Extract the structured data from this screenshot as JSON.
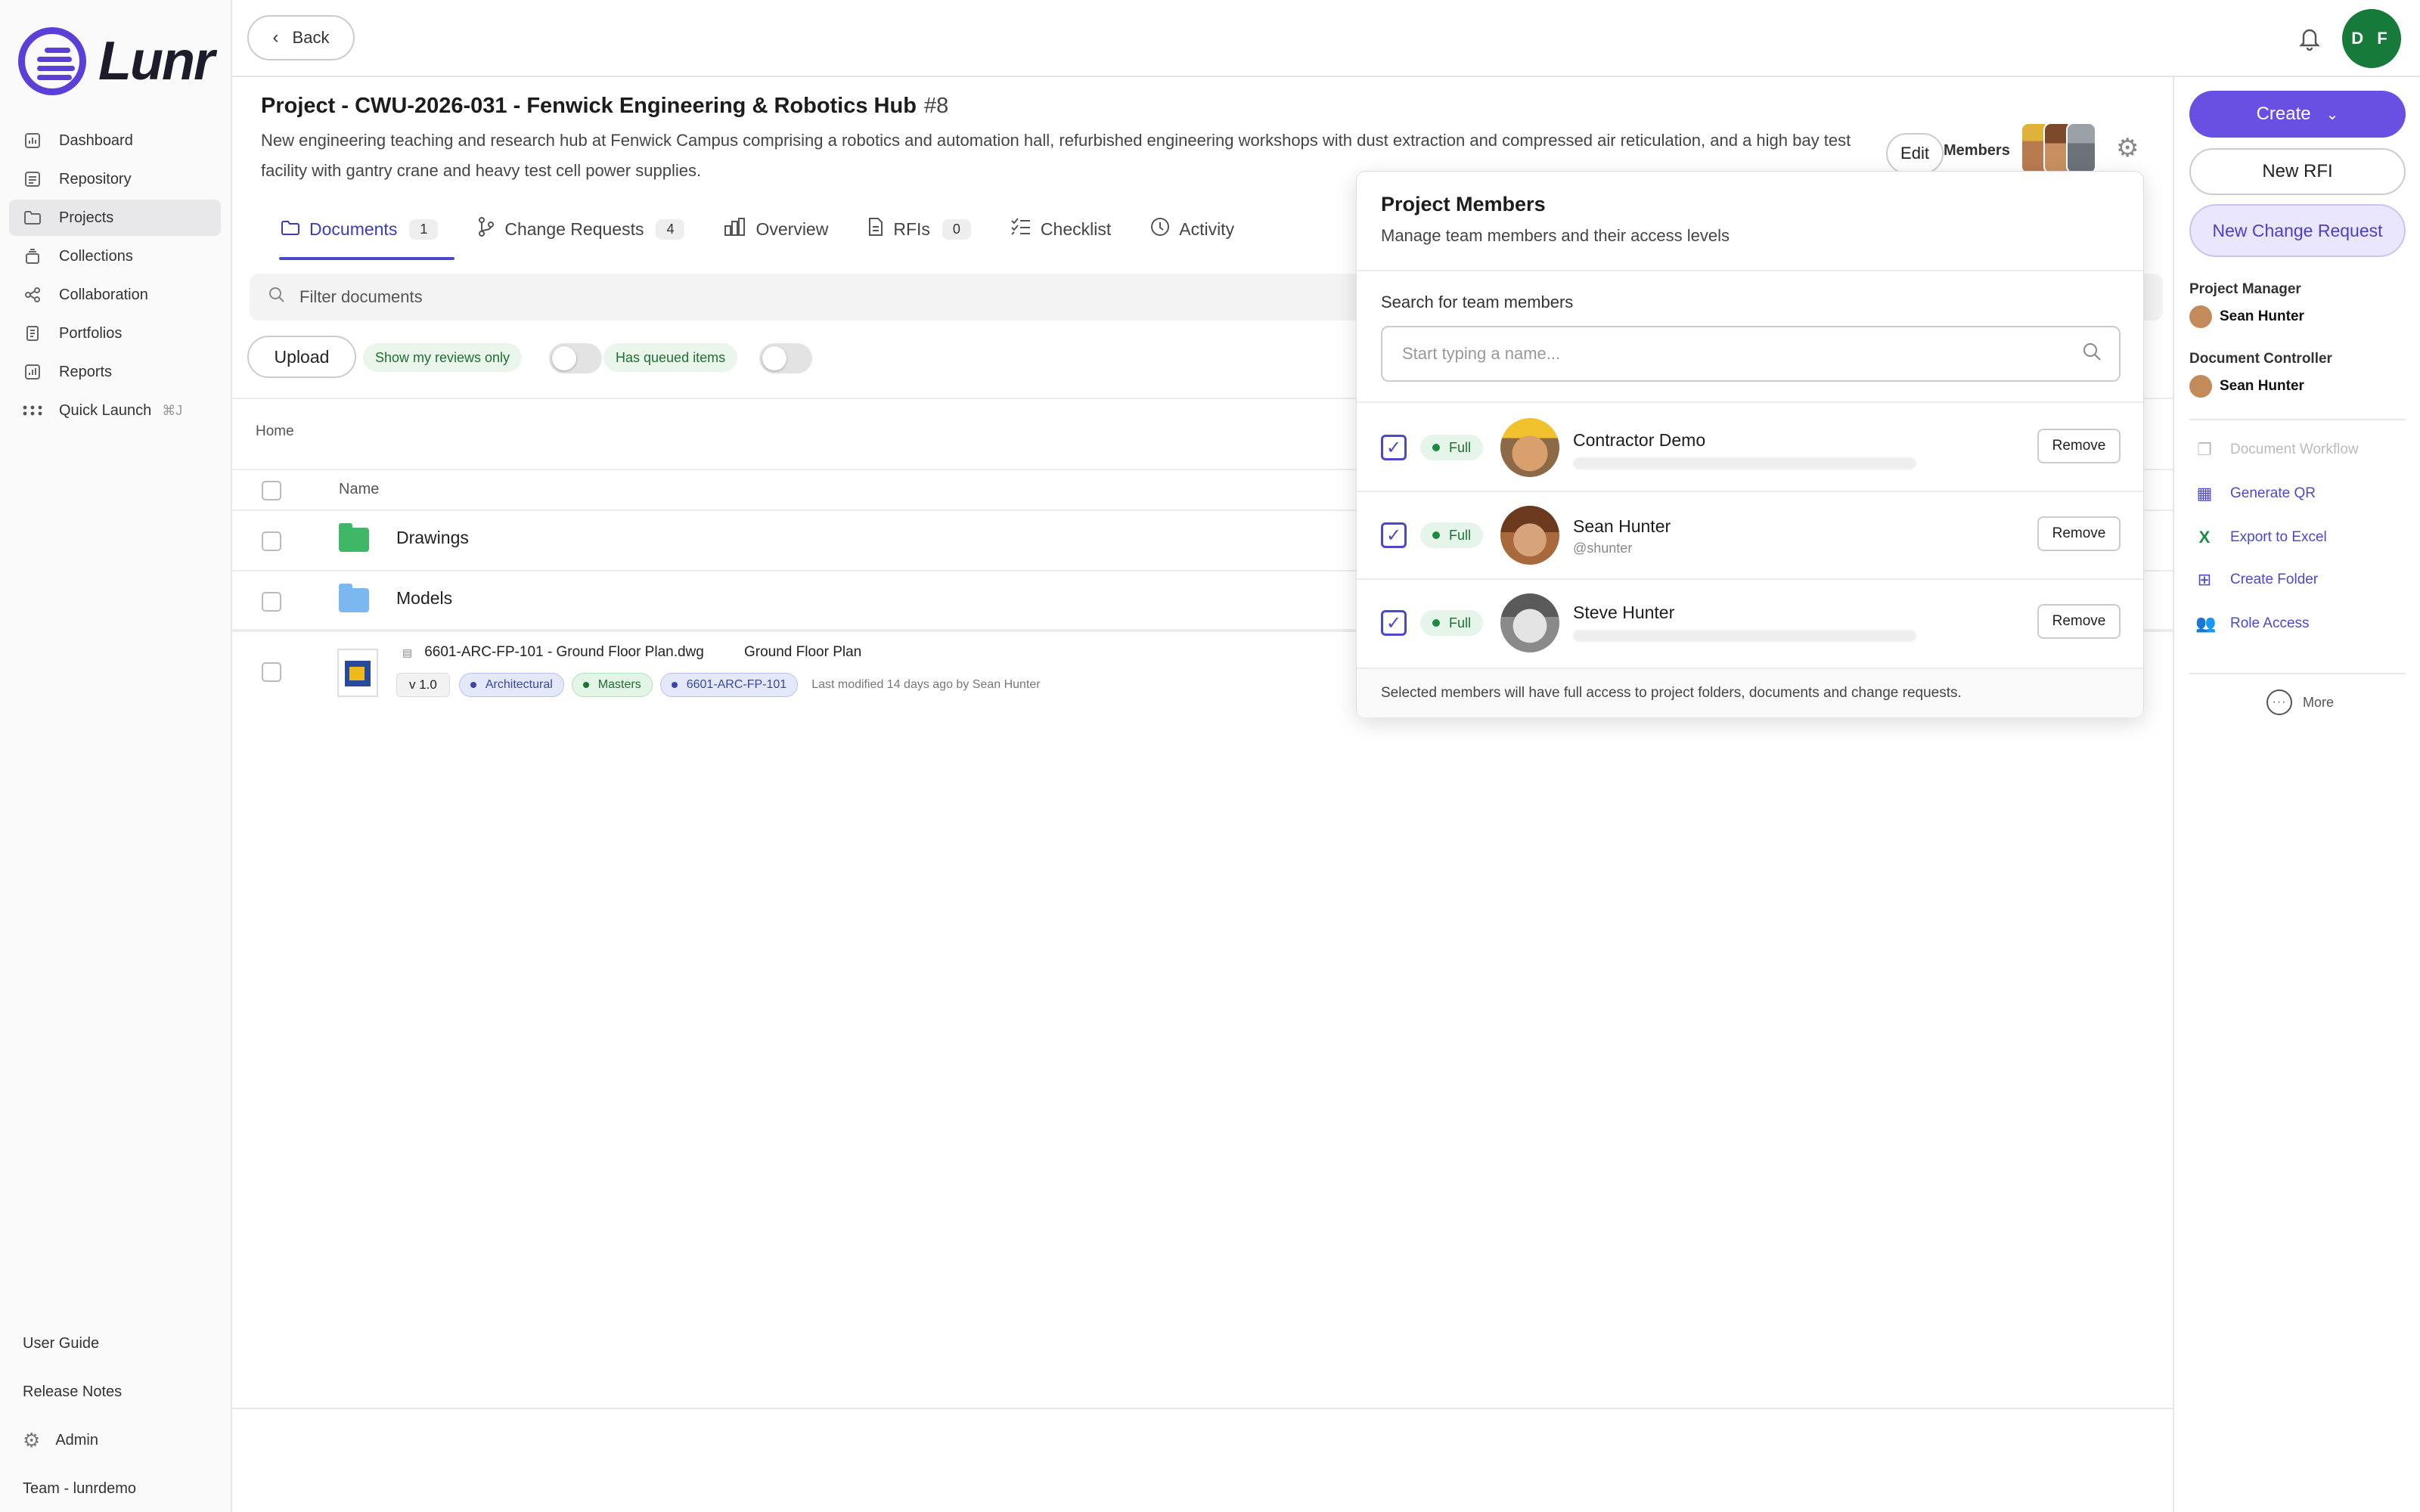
{
  "app": {
    "name": "Lunr"
  },
  "sidebar": {
    "items": [
      {
        "label": "Dashboard",
        "icon": "chart-icon"
      },
      {
        "label": "Repository",
        "icon": "repository-icon"
      },
      {
        "label": "Projects",
        "icon": "folder-icon",
        "active": true
      },
      {
        "label": "Collections",
        "icon": "collections-icon"
      },
      {
        "label": "Collaboration",
        "icon": "share-icon"
      },
      {
        "label": "Portfolios",
        "icon": "portfolio-icon"
      },
      {
        "label": "Reports",
        "icon": "report-icon"
      },
      {
        "label": "Quick Launch",
        "icon": "grid-icon",
        "shortcut": "⌘J"
      }
    ],
    "bottom": {
      "user_guide": "User Guide",
      "release_notes": "Release Notes",
      "admin": "Admin",
      "team": "Team - lunrdemo"
    }
  },
  "topbar": {
    "back_label": "Back",
    "user_initials": "D F",
    "avatar_color": "#157a3a"
  },
  "project": {
    "title": "Project - CWU-2026-031 - Fenwick Engineering & Robotics Hub",
    "number": "#8",
    "description": "New engineering teaching and research hub at Fenwick Campus comprising a robotics and automation hall, refurbished engineering workshops with dust extraction and compressed air reticulation, and a high bay test facility with gantry crane and heavy test cell power supplies.",
    "edit_label": "Edit",
    "members_label": "Members"
  },
  "tabs": [
    {
      "label": "Documents",
      "badge": "1",
      "active": true
    },
    {
      "label": "Change Requests",
      "badge": "4"
    },
    {
      "label": "Overview"
    },
    {
      "label": "RFIs",
      "badge": "0"
    },
    {
      "label": "Checklist"
    },
    {
      "label": "Activity"
    }
  ],
  "documents": {
    "filter_placeholder": "Filter documents",
    "upload_label": "Upload",
    "show_reviews_label": "Show my reviews only",
    "queued_label": "Has queued items",
    "breadcrumb": "Home",
    "column_name": "Name",
    "folders": [
      {
        "name": "Drawings",
        "color": "#3fb766"
      },
      {
        "name": "Models",
        "color": "#7cb8f0"
      }
    ],
    "file": {
      "filename": "6601-ARC-FP-101 - Ground Floor Plan.dwg",
      "title": "Ground Floor Plan",
      "version": "v 1.0",
      "tags": [
        {
          "label": "Architectural",
          "style": "blue"
        },
        {
          "label": "Masters",
          "style": "green"
        },
        {
          "label": "6601-ARC-FP-101",
          "style": "blue"
        }
      ],
      "modified": "Last modified 14 days ago by Sean Hunter"
    }
  },
  "right_panel": {
    "create_label": "Create",
    "new_rfi_label": "New RFI",
    "new_cr_label": "New Change Request",
    "accent": "#6a4fe3",
    "project_manager_label": "Project Manager",
    "project_manager": "Sean Hunter",
    "doc_controller_label": "Document Controller",
    "doc_controller": "Sean Hunter",
    "actions": [
      {
        "label": "Document Workflow",
        "disabled": true
      },
      {
        "label": "Generate QR"
      },
      {
        "label": "Export to Excel"
      },
      {
        "label": "Create Folder"
      },
      {
        "label": "Role Access"
      }
    ],
    "more_label": "More"
  },
  "members_popover": {
    "title": "Project Members",
    "subtitle": "Manage team members and their access levels",
    "search_label": "Search for team members",
    "search_placeholder": "Start typing a name...",
    "members": [
      {
        "name": "Contractor Demo",
        "sub": "",
        "access": "Full",
        "remove": "Remove"
      },
      {
        "name": "Sean Hunter",
        "sub": "@shunter",
        "access": "Full",
        "remove": "Remove"
      },
      {
        "name": "Steve Hunter",
        "sub": "",
        "access": "Full",
        "remove": "Remove"
      }
    ],
    "footer": "Selected members will have full access to project folders, documents and change requests."
  }
}
